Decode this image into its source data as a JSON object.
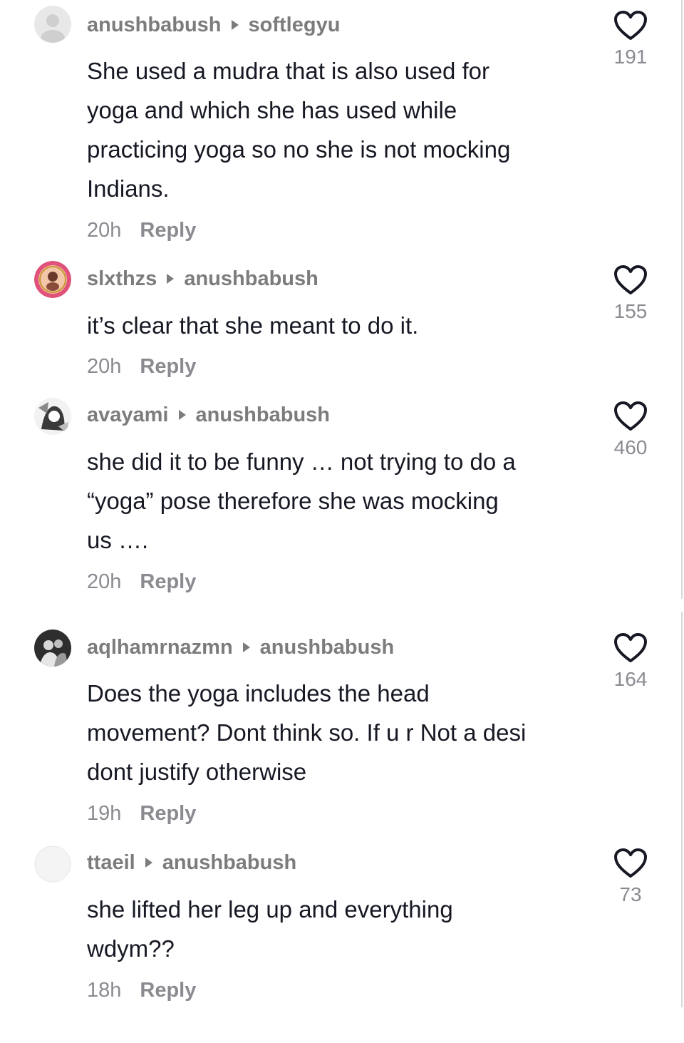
{
  "comments": [
    {
      "user": "anushbabush",
      "reply_to": "softlegyu",
      "text_lines": [
        "She used a mudra that is also used for",
        "yoga and which she has used while",
        "practicing yoga so no she is not mocking",
        "Indians."
      ],
      "time": "20h",
      "reply_label": "Reply",
      "likes": "191",
      "avatar": "default-avatar-icon"
    },
    {
      "user": "slxthzs",
      "reply_to": "anushbabush",
      "text_lines": [
        "it’s clear that she meant to do it."
      ],
      "time": "20h",
      "reply_label": "Reply",
      "likes": "155",
      "avatar": "profile-photo"
    },
    {
      "user": "avayami",
      "reply_to": "anushbabush",
      "text_lines": [
        "she did it to be funny … not trying to do a",
        "“yoga” pose therefore she was mocking",
        "us …."
      ],
      "time": "20h",
      "reply_label": "Reply",
      "likes": "460",
      "avatar": "profile-photo"
    },
    {
      "user": "aqlhamrnazmn",
      "reply_to": "anushbabush",
      "text_lines": [
        "Does the yoga includes the head",
        "movement? Dont think so. If u r Not a desi",
        "dont justify otherwise"
      ],
      "time": "19h",
      "reply_label": "Reply",
      "likes": "164",
      "avatar": "profile-photo"
    },
    {
      "user": "ttaeil",
      "reply_to": "anushbabush",
      "text_lines": [
        "she lifted her leg up and everything",
        "wdym??"
      ],
      "time": "18h",
      "reply_label": "Reply",
      "likes": "73",
      "avatar": "default-avatar-icon"
    }
  ],
  "colors": {
    "username": "#7c7c7e",
    "body_text": "#161823",
    "meta": "#8a8b91",
    "heart_outline": "#161823"
  }
}
